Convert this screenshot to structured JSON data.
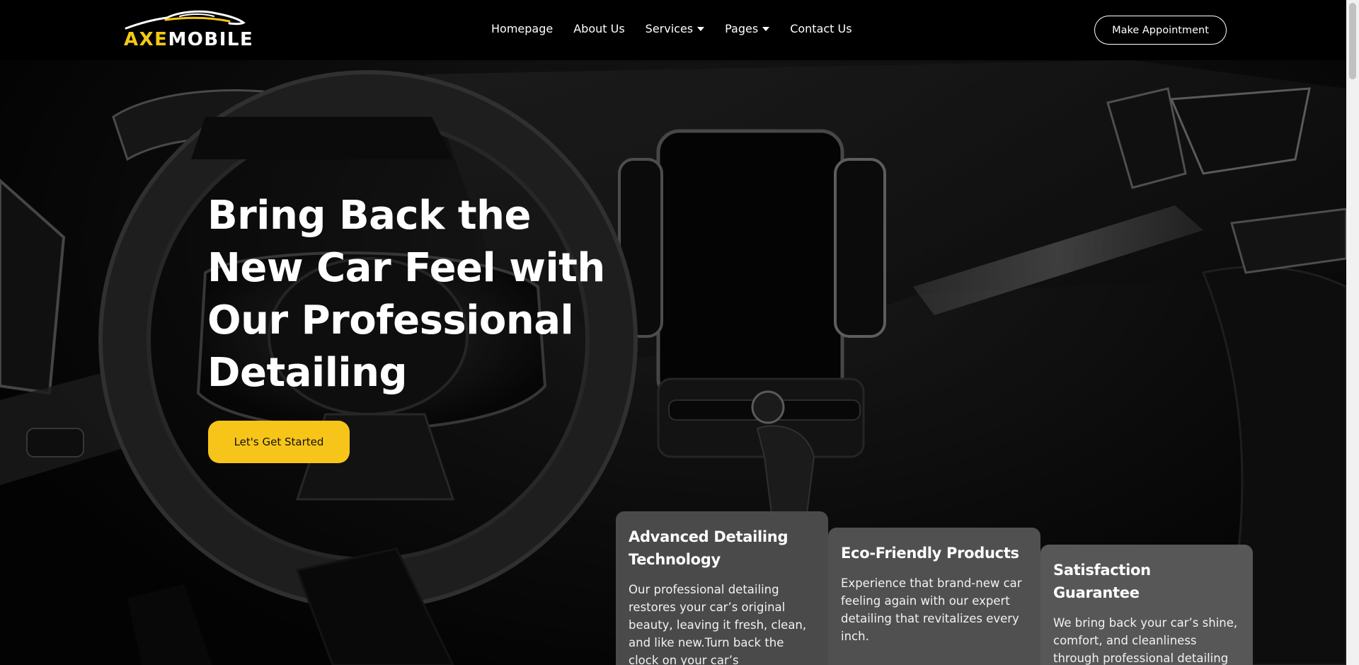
{
  "brand": {
    "logo_part1": "AXE",
    "logo_part2": "MOBILE",
    "accent_color": "#f7c519"
  },
  "nav": {
    "items": [
      {
        "label": "Homepage",
        "dropdown": false
      },
      {
        "label": "About Us",
        "dropdown": false
      },
      {
        "label": "Services",
        "dropdown": true
      },
      {
        "label": "Pages",
        "dropdown": true
      },
      {
        "label": "Contact Us",
        "dropdown": false
      }
    ],
    "appointment_label": "Make Appointment"
  },
  "hero": {
    "title": "Bring Back the New Car Feel with Our Professional Detailing",
    "cta_label": "Let's Get Started"
  },
  "features": [
    {
      "title": "Advanced Detailing Technology",
      "text": "Our professional detailing restores your car’s original beauty, leaving it fresh, clean, and like new.Turn back the clock on your car’s"
    },
    {
      "title": "Eco-Friendly Products",
      "text": "Experience that brand-new car feeling again with our expert detailing that revitalizes every inch."
    },
    {
      "title": "Satisfaction Guarantee",
      "text": "We bring back your car’s shine, comfort, and cleanliness through professional detailing services."
    }
  ]
}
